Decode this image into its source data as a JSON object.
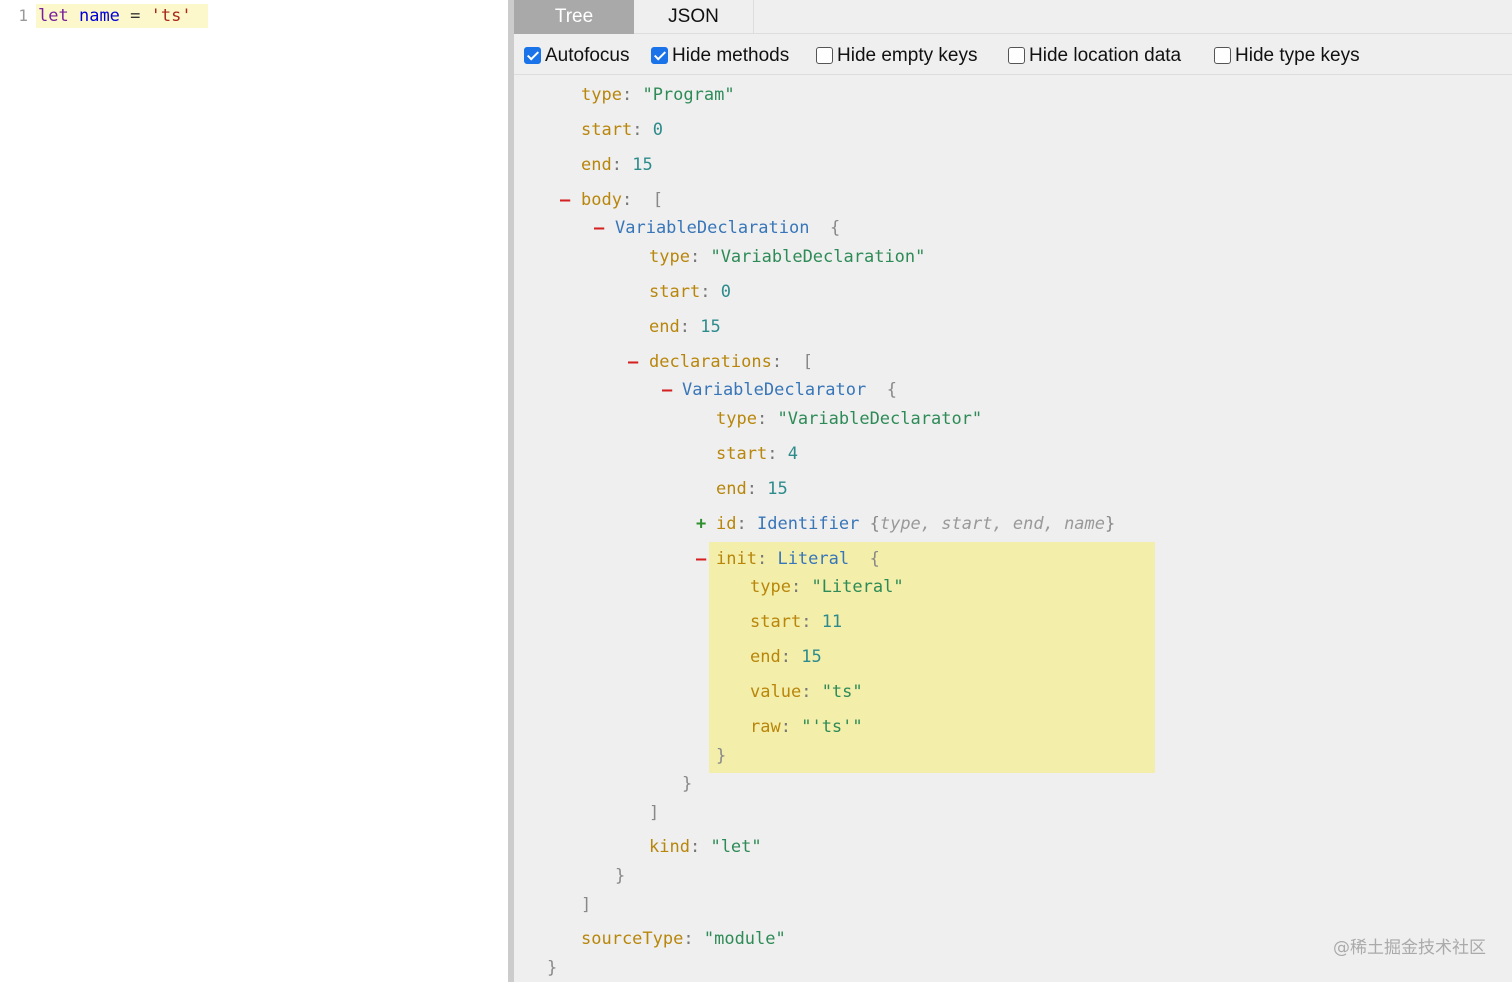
{
  "editor": {
    "line_number": "1",
    "code": {
      "keyword": "let",
      "identifier": "name",
      "operator": "=",
      "string": "'ts'"
    }
  },
  "tabs": [
    {
      "label": "Tree",
      "active": true
    },
    {
      "label": "JSON",
      "active": false
    }
  ],
  "options": [
    {
      "label": "Autofocus",
      "checked": true
    },
    {
      "label": "Hide methods",
      "checked": true
    },
    {
      "label": "Hide empty keys",
      "checked": false
    },
    {
      "label": "Hide location data",
      "checked": false
    },
    {
      "label": "Hide type keys",
      "checked": false
    }
  ],
  "tree": {
    "program": {
      "type_key": "type",
      "type_val": "\"Program\"",
      "start_key": "start",
      "start_val": "0",
      "end_key": "end",
      "end_val": "15",
      "body_key": "body",
      "source_type_key": "sourceType",
      "source_type_val": "\"module\""
    },
    "declaration": {
      "node": "VariableDeclaration",
      "type_key": "type",
      "type_val": "\"VariableDeclaration\"",
      "start_key": "start",
      "start_val": "0",
      "end_key": "end",
      "end_val": "15",
      "declarations_key": "declarations",
      "kind_key": "kind",
      "kind_val": "\"let\""
    },
    "declarator": {
      "node": "VariableDeclarator",
      "type_key": "type",
      "type_val": "\"VariableDeclarator\"",
      "start_key": "start",
      "start_val": "4",
      "end_key": "end",
      "end_val": "15",
      "id_key": "id",
      "id_node": "Identifier",
      "id_summary": "type, start, end, name",
      "init_key": "init",
      "init_node": "Literal"
    },
    "literal": {
      "type_key": "type",
      "type_val": "\"Literal\"",
      "start_key": "start",
      "start_val": "11",
      "end_key": "end",
      "end_val": "15",
      "value_key": "value",
      "value_val": "\"ts\"",
      "raw_key": "raw",
      "raw_val": "\"'ts'\""
    },
    "glyphs": {
      "collapse": "–",
      "expand": "+",
      "open_brace": "{",
      "close_brace": "}",
      "open_bracket": "[",
      "close_bracket": "]",
      "colon": ":"
    }
  },
  "watermark": "@稀土掘金技术社区",
  "colors": {
    "active_tab": "#a9a9a9",
    "highlight": "#f3eeaa",
    "key": "#b8860b",
    "string": "#2e8b57",
    "node_type": "#3876b8",
    "collapse": "#d42020",
    "expand": "#2f8f2f"
  }
}
